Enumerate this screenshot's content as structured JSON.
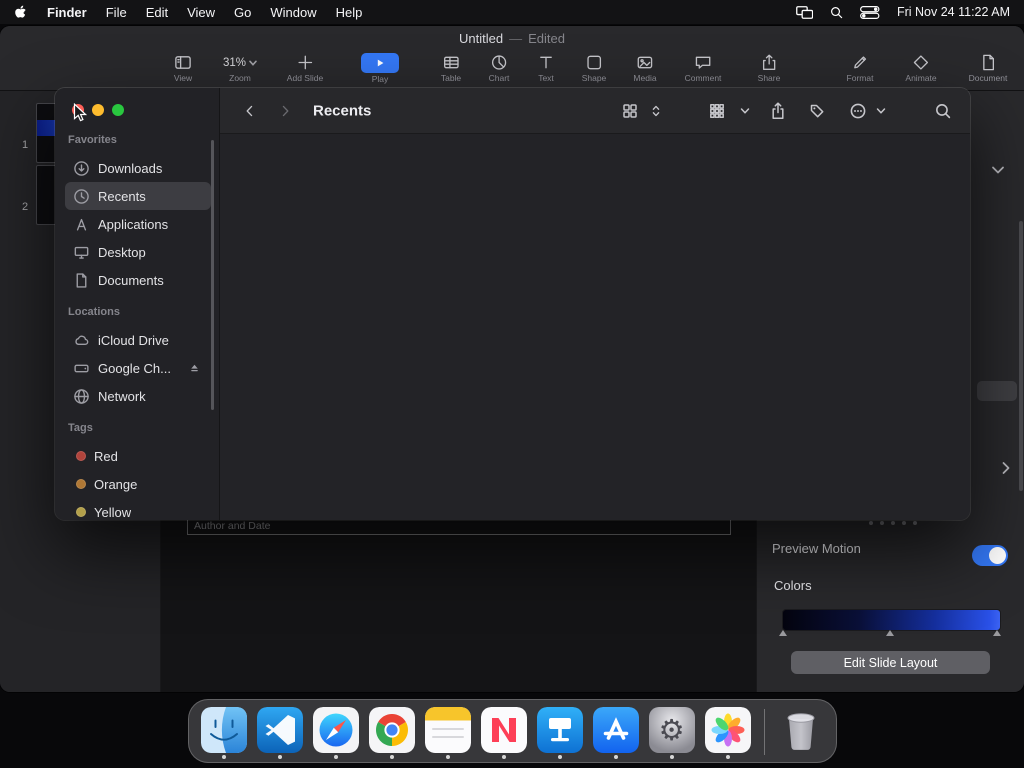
{
  "menubar": {
    "app_name": "Finder",
    "menus": [
      "File",
      "Edit",
      "View",
      "Go",
      "Window",
      "Help"
    ],
    "clock": "Fri Nov 24 11:22 AM"
  },
  "keynote": {
    "title": "Untitled",
    "separator": "—",
    "edited": "Edited",
    "zoom_value": "31%",
    "toolbar": {
      "view": "View",
      "zoom": "Zoom",
      "add_slide": "Add Slide",
      "play": "Play",
      "table": "Table",
      "chart": "Chart",
      "text": "Text",
      "shape": "Shape",
      "media": "Media",
      "comment": "Comment",
      "share": "Share",
      "format": "Format",
      "animate": "Animate",
      "document": "Document"
    },
    "slides": [
      "1",
      "2"
    ],
    "canvas": {
      "author_date_placeholder": "Author and Date"
    },
    "inspector": {
      "preview_motion_label": "Preview Motion",
      "colors_label": "Colors",
      "edit_slide_layout_label": "Edit Slide Layout",
      "preview_motion_on": true
    }
  },
  "finder": {
    "title": "Recents",
    "selected_item": "Recents",
    "sidebar": {
      "favorites": {
        "header": "Favorites",
        "items": [
          "Downloads",
          "Recents",
          "Applications",
          "Desktop",
          "Documents"
        ]
      },
      "locations": {
        "header": "Locations",
        "items": [
          "iCloud Drive",
          "Google Ch...",
          "Network"
        ]
      },
      "tags": {
        "header": "Tags",
        "items": [
          "Red",
          "Orange",
          "Yellow"
        ],
        "colors": [
          "#b1443c",
          "#b07835",
          "#b3a04a"
        ]
      }
    }
  },
  "dock": {
    "apps": [
      "finder",
      "vscode",
      "safari",
      "chrome",
      "notes",
      "news",
      "keynote",
      "app-store",
      "settings",
      "photos",
      "trash"
    ]
  },
  "colors": {
    "accent_blue": "#3478f6",
    "toggle_on": "#3478f6",
    "gradient_start": "#04040f",
    "gradient_end": "#3c63f2"
  }
}
